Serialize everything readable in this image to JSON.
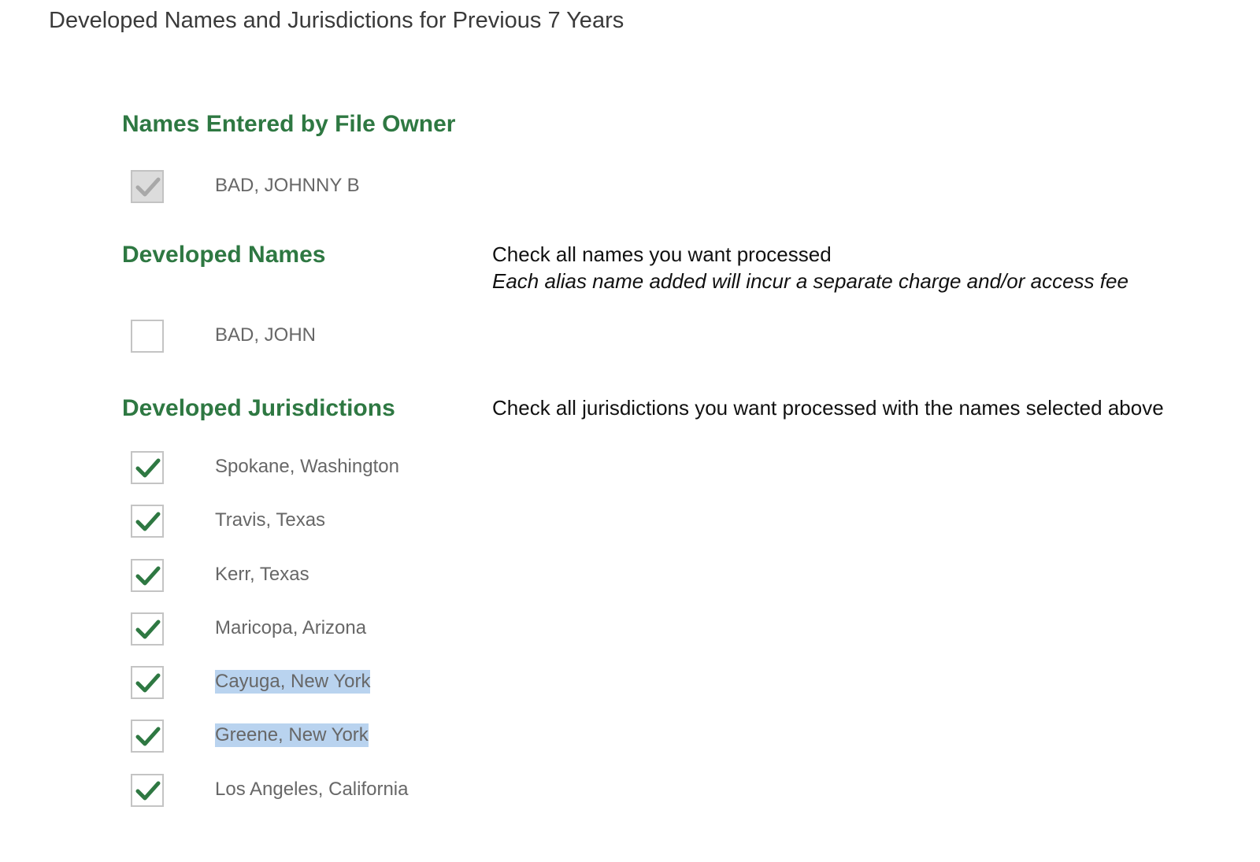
{
  "page_title": "Developed Names and Jurisdictions for Previous 7 Years",
  "owner_names": {
    "heading": "Names Entered by File Owner",
    "items": [
      {
        "label": "BAD, JOHNNY B",
        "checked": true,
        "disabled": true
      }
    ]
  },
  "developed_names": {
    "heading": "Developed Names",
    "instruction": "Check all names you want processed",
    "note": "Each alias name added will incur a separate charge and/or access fee",
    "items": [
      {
        "label": "BAD, JOHN",
        "checked": false
      }
    ]
  },
  "developed_jurisdictions": {
    "heading": "Developed Jurisdictions",
    "instruction": "Check all jurisdictions you want processed with the names selected above",
    "items": [
      {
        "label": "Spokane, Washington",
        "checked": true
      },
      {
        "label": "Travis, Texas",
        "checked": true
      },
      {
        "label": "Kerr, Texas",
        "checked": true
      },
      {
        "label": "Maricopa, Arizona",
        "checked": true
      },
      {
        "label": "Cayuga, New York",
        "checked": true,
        "text_selected": true
      },
      {
        "label": "Greene, New York",
        "checked": true,
        "text_selected": true
      },
      {
        "label": "Los Angeles, California",
        "checked": true
      }
    ]
  },
  "colors": {
    "heading_green": "#2e7842",
    "check_green": "#2e7842",
    "check_disabled": "#a8a8a8",
    "selection_highlight": "#b9d3ef"
  },
  "icons": {
    "check": "checkmark-icon"
  }
}
